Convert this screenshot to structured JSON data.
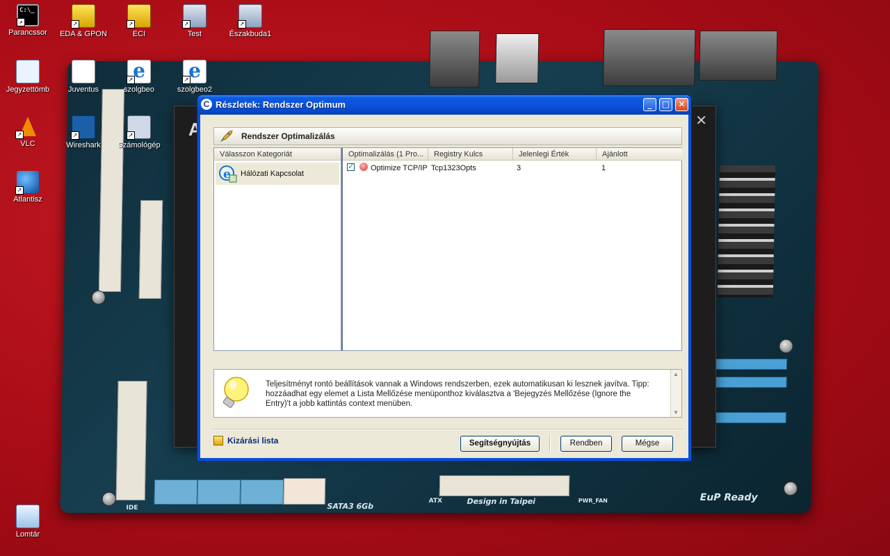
{
  "desktop": {
    "icons": [
      {
        "label": "Parancssor"
      },
      {
        "label": "EDA & GPON"
      },
      {
        "label": "ECI"
      },
      {
        "label": "Test"
      },
      {
        "label": "Északbuda1"
      },
      {
        "label": "Jegyzettömb"
      },
      {
        "label": "Juventus"
      },
      {
        "label": "szolgbeo"
      },
      {
        "label": "szolgbeo2"
      },
      {
        "label": "VLC"
      },
      {
        "label": "Wireshark"
      },
      {
        "label": "Számológép"
      },
      {
        "label": "Atlantisz"
      },
      {
        "label": "Lomtár"
      }
    ],
    "wallpaper_text": [
      "Design in Taipei",
      "EuP Ready",
      "SATA3 6Gb",
      "IDE",
      "ATX",
      "PWR_FAN"
    ]
  },
  "dialog": {
    "title": "Részletek: Rendszer Optimum",
    "header": "Rendszer Optimalizálás",
    "categories": {
      "header": "Válasszon Kategoriát",
      "items": [
        {
          "label": "Hálózati Kapcsolat"
        }
      ]
    },
    "table": {
      "columns": [
        "Optimalizálás (1 Pro...",
        "Registry Kulcs",
        "Jelenlegi Érték",
        "Ajánlott"
      ],
      "rows": [
        {
          "checked": true,
          "name": "Optimize TCP/IP",
          "key": "Tcp1323Opts",
          "current": "3",
          "recommended": "1"
        }
      ]
    },
    "tip": "Teljesítményt rontó beállítások vannak a Windows rendszerben, ezek automatikusan ki lesznek javítva. Tipp: hozzáadhat egy elemet a Lista Mellőzése menüponthoz kiválasztva a 'Bejegyzés Mellőzése (Ignore the Entry)'t a jobb kattintás context menüben.",
    "exclusion_link": "Kizárási lista",
    "buttons": {
      "help": "Segítségnyújtás",
      "ok": "Rendben",
      "cancel": "Mégse"
    }
  },
  "colors": {
    "titlebar": "#0a4fd8",
    "client": "#ece9d8",
    "wallpaper": "#b3111a"
  }
}
